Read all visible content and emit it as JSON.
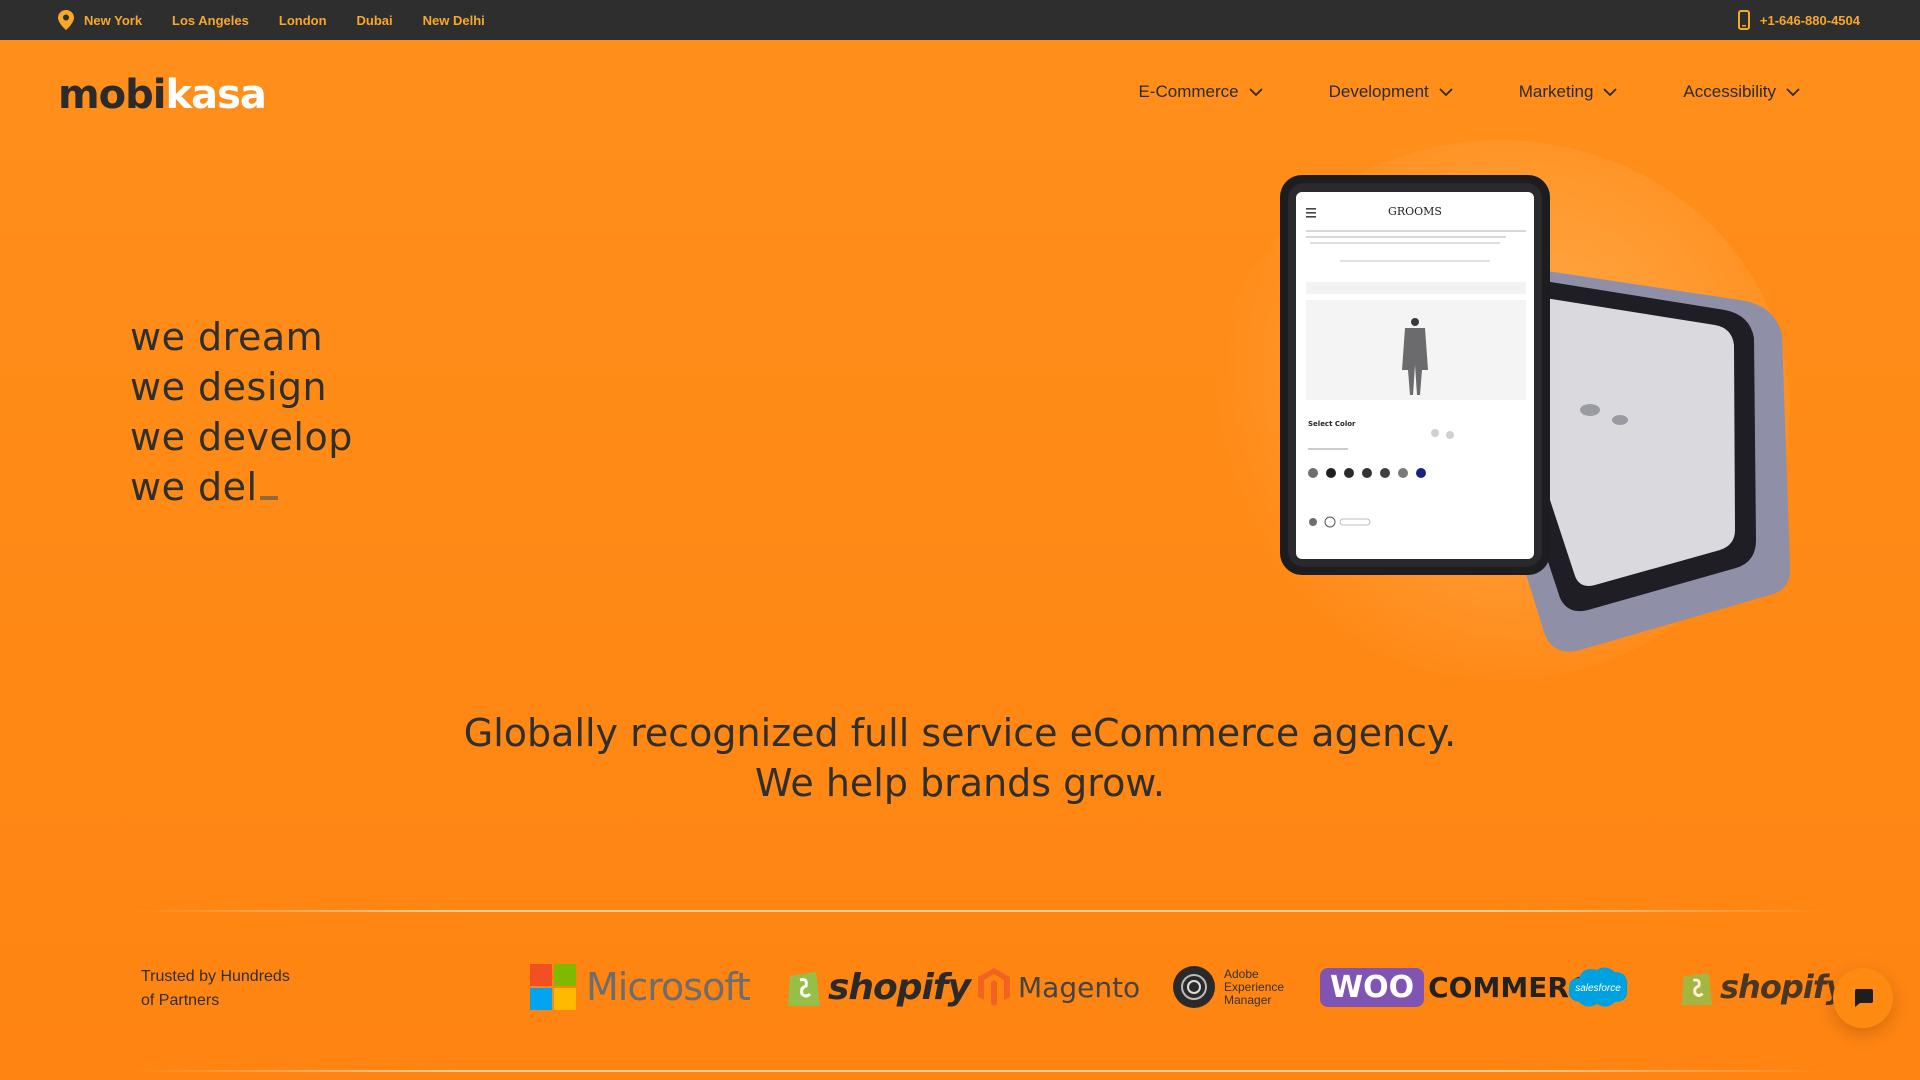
{
  "topbar": {
    "locations": [
      "New York",
      "Los Angeles",
      "London",
      "Dubai",
      "New Delhi"
    ],
    "phone": "+1-646-880-4504",
    "icons": {
      "location": "map-pin-icon",
      "phone": "mobile-phone-icon"
    },
    "colors": {
      "background": "#2e2e2e",
      "text": "#f6a82a"
    }
  },
  "header": {
    "logo_part1": "mobi",
    "logo_part2": "kasa",
    "nav": [
      {
        "label": "E-Commerce"
      },
      {
        "label": "Development"
      },
      {
        "label": "Marketing"
      },
      {
        "label": "Accessibility"
      }
    ]
  },
  "hero": {
    "lines": [
      "we dream",
      "we design",
      "we develop",
      "we del"
    ],
    "device_screen": {
      "brand": "GROOMS",
      "section_title": "Select Color"
    }
  },
  "tagline": {
    "line1": "Globally recognized full service eCommerce agency.",
    "line2": "We help brands grow."
  },
  "partners": {
    "trusted_line1": "Trusted by Hundreds",
    "trusted_line2": "of Partners",
    "logos": {
      "microsoft": "Microsoft",
      "shopify": "shopify",
      "magento": "Magento",
      "adobe": "Adobe Experience Manager",
      "woo": "WOO",
      "commerce": "COMMERCE",
      "salesforce": "salesforce",
      "shopify2": "shopify"
    }
  },
  "colors": {
    "brand_orange": "#ff8a16",
    "text_dark": "#2f2f2f"
  },
  "chat": {
    "icon": "chat-bubble-icon"
  }
}
